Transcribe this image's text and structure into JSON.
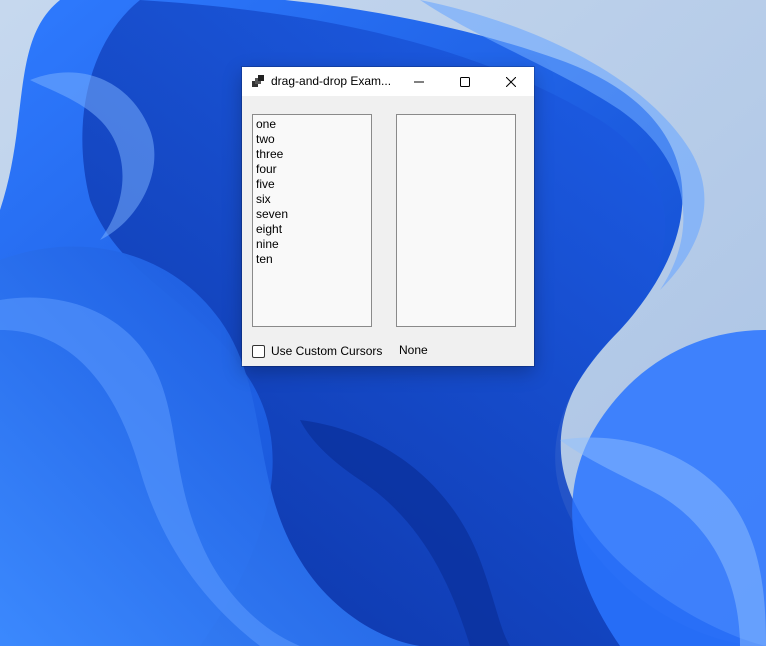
{
  "window": {
    "title": "drag-and-drop Exam...",
    "controls": {
      "minimize": "minimize-icon",
      "maximize": "maximize-icon",
      "close": "close-icon"
    }
  },
  "source_list": {
    "items": [
      "one",
      "two",
      "three",
      "four",
      "five",
      "six",
      "seven",
      "eight",
      "nine",
      "ten"
    ]
  },
  "target_list": {
    "items": []
  },
  "custom_cursors": {
    "label": "Use Custom Cursors",
    "checked": false
  },
  "status": {
    "text": "None"
  },
  "colors": {
    "wallpaper_base": "#b9cfe9",
    "wallpaper_blue": "#1a5fe0",
    "window_bg": "#f0f0f0",
    "listbox_bg": "#f9f9f9"
  }
}
